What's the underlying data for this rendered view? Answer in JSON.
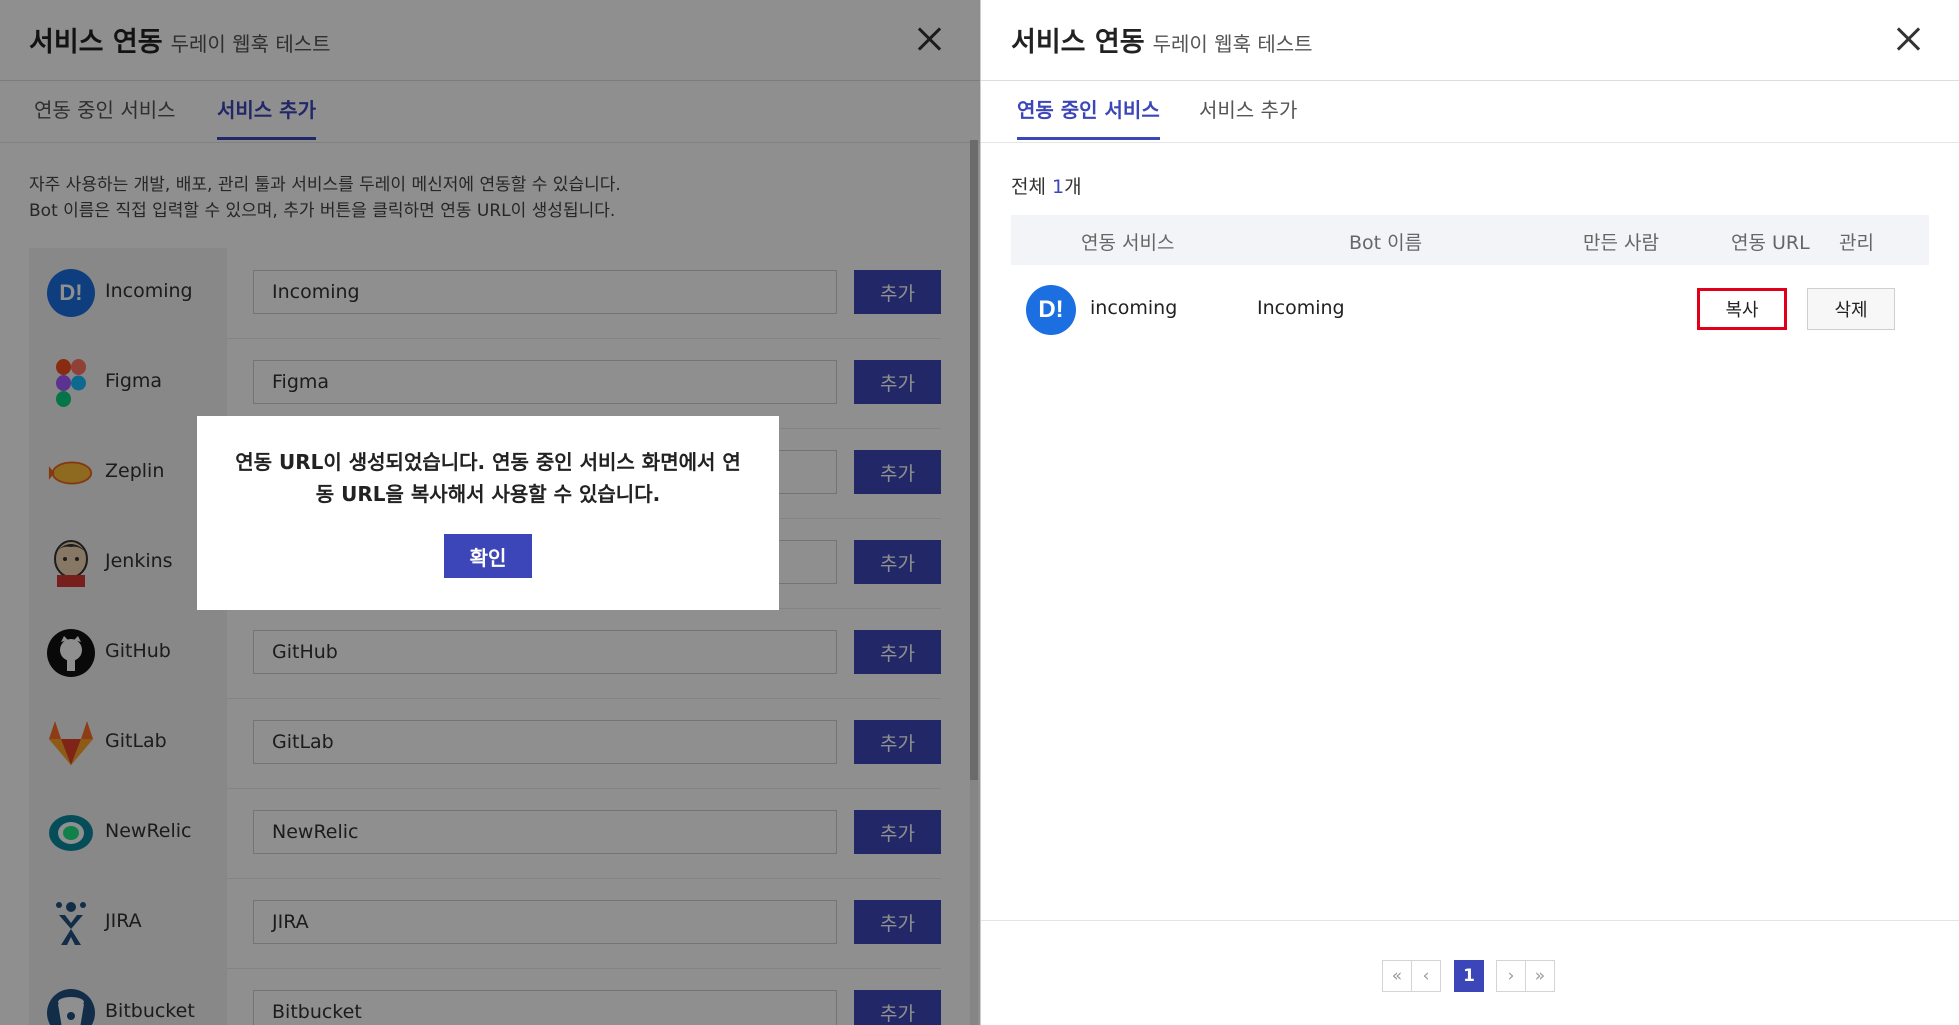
{
  "left_panel": {
    "title": "서비스 연동",
    "subtitle": "두레이 웹훅 테스트",
    "tabs": [
      {
        "label": "연동 중인 서비스",
        "active": false
      },
      {
        "label": "서비스 추가",
        "active": true
      }
    ],
    "description": [
      "자주 사용하는 개발, 배포, 관리 툴과 서비스를 두레이 메신저에 연동할 수 있습니다.",
      "Bot 이름은 직접 입력할 수 있으며, 추가 버튼을 클릭하면 연동 URL이 생성됩니다."
    ],
    "add_label": "추가",
    "services": [
      {
        "name": "Incoming",
        "input_value": "Incoming",
        "icon": "dooray-icon"
      },
      {
        "name": "Figma",
        "input_value": "Figma",
        "icon": "figma-icon"
      },
      {
        "name": "Zeplin",
        "input_value": "",
        "icon": "zeplin-icon"
      },
      {
        "name": "Jenkins",
        "input_value": "",
        "icon": "jenkins-icon"
      },
      {
        "name": "GitHub",
        "input_value": "GitHub",
        "icon": "github-icon"
      },
      {
        "name": "GitLab",
        "input_value": "GitLab",
        "icon": "gitlab-icon"
      },
      {
        "name": "NewRelic",
        "input_value": "NewRelic",
        "icon": "newrelic-icon"
      },
      {
        "name": "JIRA",
        "input_value": "JIRA",
        "icon": "jira-icon"
      },
      {
        "name": "Bitbucket",
        "input_value": "Bitbucket",
        "icon": "bitbucket-icon"
      }
    ]
  },
  "modal": {
    "message_line1": "연동 URL이 생성되었습니다. 연동 중인 서비스 화면에서 연",
    "message_line2": "동 URL을 복사해서 사용할 수 있습니다.",
    "confirm_label": "확인"
  },
  "right_panel": {
    "title": "서비스 연동",
    "subtitle": "두레이 웹훅 테스트",
    "tabs": [
      {
        "label": "연동 중인 서비스",
        "active": true
      },
      {
        "label": "서비스 추가",
        "active": false
      }
    ],
    "total_label": "전체",
    "total_count": "1",
    "total_unit": "개",
    "table_headers": [
      "연동 서비스",
      "Bot 이름",
      "만든 사람",
      "연동 URL",
      "관리"
    ],
    "rows": [
      {
        "service": "incoming",
        "bot_name": "Incoming",
        "creator": "",
        "copy_label": "복사",
        "delete_label": "삭제",
        "icon": "dooray-icon"
      }
    ],
    "pagination": {
      "current_page": "1",
      "first": "«",
      "prev": "‹",
      "next": "›",
      "last": "»"
    }
  },
  "colors": {
    "accent": "#3d46b8",
    "highlight": "#e0001a",
    "dooray_blue": "#1c6fe0"
  }
}
